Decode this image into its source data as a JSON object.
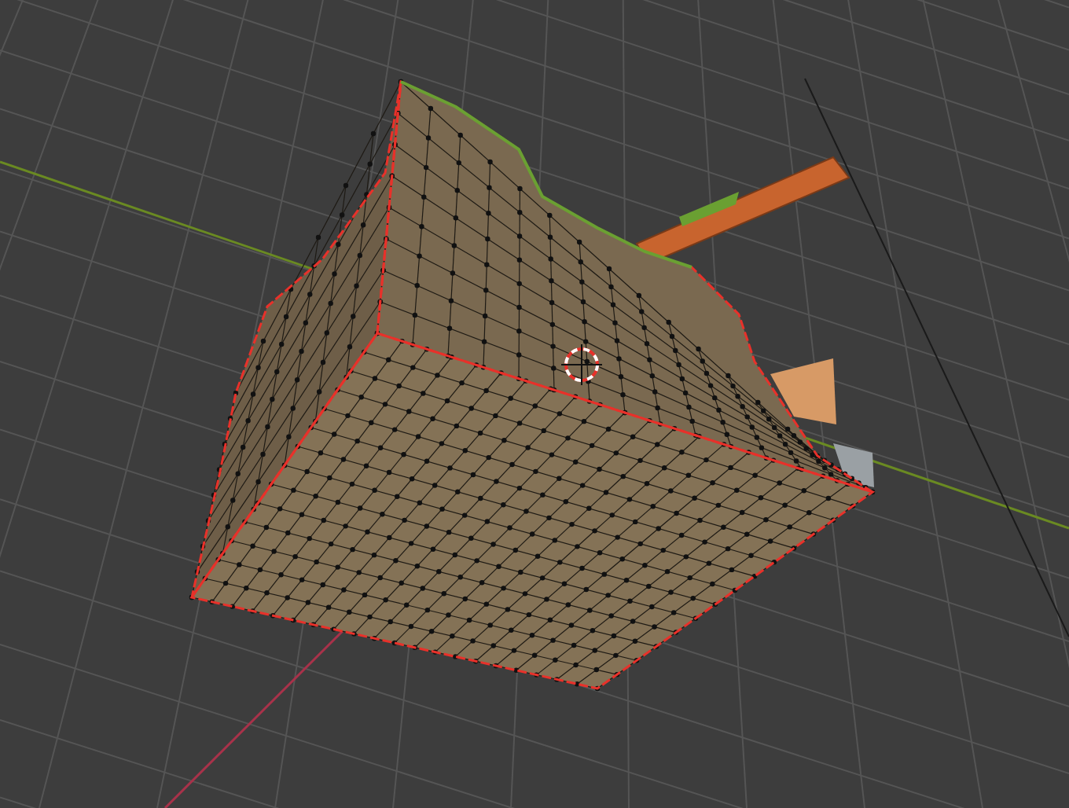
{
  "viewport": {
    "grid_visible": true,
    "cursor_visible": true,
    "mesh_selected": true
  }
}
